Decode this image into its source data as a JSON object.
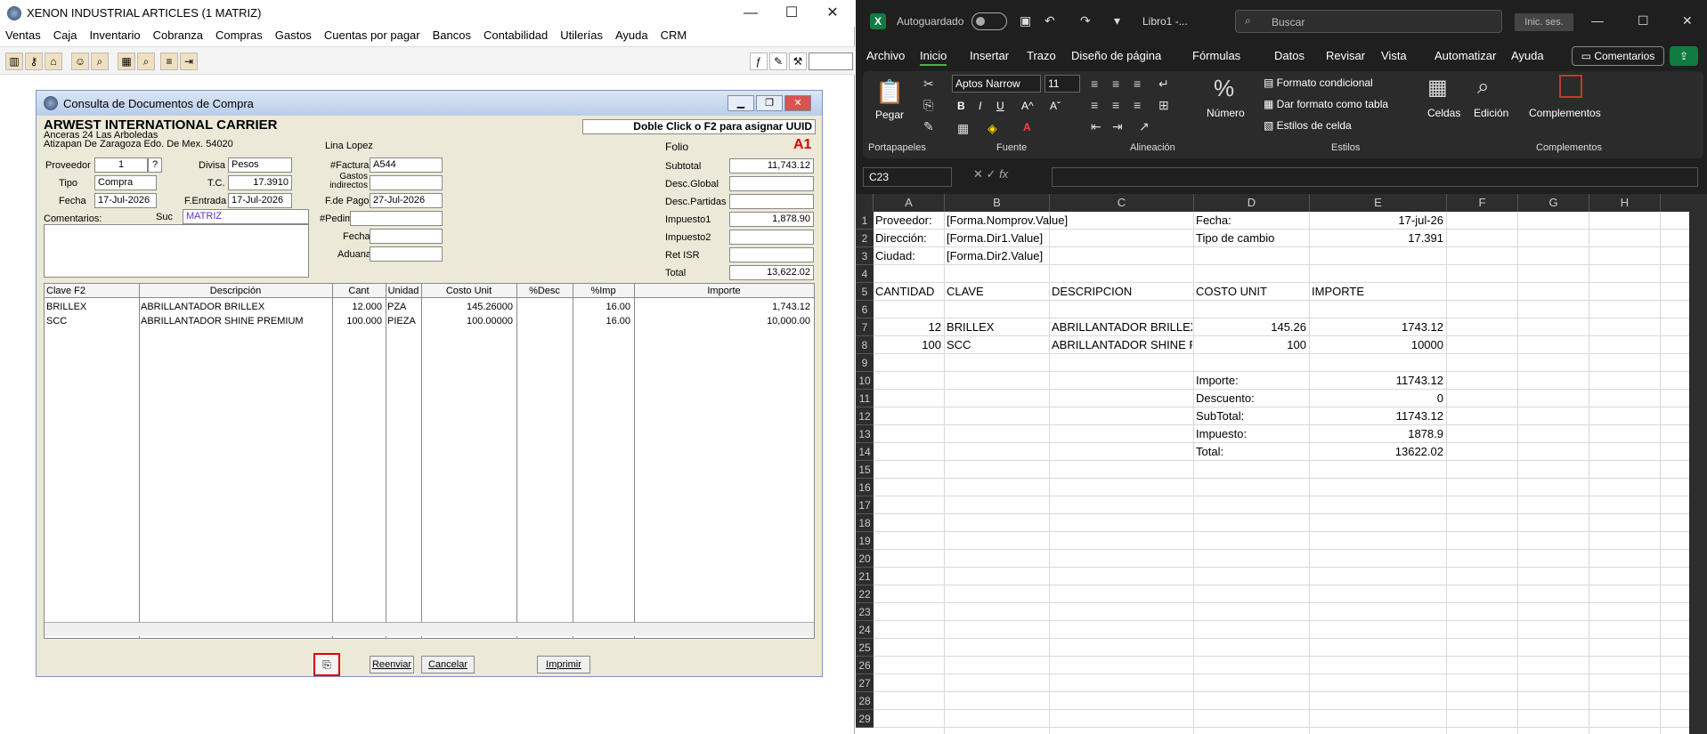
{
  "xenon": {
    "title": "XENON INDUSTRIAL ARTICLES  (1 MATRIZ)",
    "menu": [
      "Ventas",
      "Caja",
      "Inventario",
      "Cobranza",
      "Compras",
      "Gastos",
      "Cuentas por pagar",
      "Bancos",
      "Contabilidad",
      "Utilerías",
      "Ayuda",
      "CRM"
    ],
    "dialog": {
      "title": "Consulta de Documentos de Compra",
      "supplier_name": "ARWEST INTERNATIONAL CARRIER",
      "address1": "Anceras 24 Las Arboledas",
      "address2": "Atizapan De Zaragoza Edo. De Mex. 54020",
      "contact": "Lina Lopez",
      "uuid_hint": "Doble Click o F2 para asignar UUID",
      "folio_label": "Folio",
      "folio_value": "A1",
      "labels": {
        "proveedor": "Proveedor",
        "tipo": "Tipo",
        "fecha": "Fecha",
        "divisa": "Divisa",
        "tc": "T.C.",
        "fentrada": "F.Entrada",
        "factura": "#Factura",
        "gastos": "Gastos indirectos",
        "fpago": "F.de Pago",
        "comentarios": "Comentarios:",
        "suc": "Suc",
        "pedim": "#Pedim",
        "fecha2": "Fecha",
        "aduana": "Aduana"
      },
      "values": {
        "proveedor": "1",
        "tipo": "Compra",
        "fecha": "17-Jul-2026",
        "divisa": "Pesos",
        "tc": "17.3910",
        "fentrada": "17-Jul-2026",
        "factura": "A544",
        "fpago": "27-Jul-2026",
        "suc": "MATRIZ"
      },
      "totals": [
        {
          "label": "Subtotal",
          "value": "11,743.12"
        },
        {
          "label": "Desc.Global",
          "value": ""
        },
        {
          "label": "Desc.Partidas",
          "value": ""
        },
        {
          "label": "Impuesto1",
          "value": "1,878.90"
        },
        {
          "label": "Impuesto2",
          "value": ""
        },
        {
          "label": "Ret ISR",
          "value": ""
        },
        {
          "label": "Total",
          "value": "13,622.02"
        }
      ],
      "grid_headers": [
        "Clave  F2",
        "Descripción",
        "Cant",
        "Unidad",
        "Costo Unit",
        "%Desc",
        "%Imp",
        "Importe"
      ],
      "rows": [
        [
          "BRILLEX",
          "ABRILLANTADOR BRILLEX",
          "12.000",
          "PZA",
          "145.26000",
          "",
          "16.00",
          "1,743.12"
        ],
        [
          "SCC",
          "ABRILLANTADOR SHINE PREMIUM",
          "100.000",
          "PIEZA",
          "100.00000",
          "",
          "16.00",
          "10,000.00"
        ]
      ],
      "buttons": {
        "reenviar": "Reenviar",
        "cancelar": "Cancelar",
        "imprimir": "Imprimir"
      }
    }
  },
  "excel": {
    "autosave": "Autoguardado",
    "filename": "Libro1 -...",
    "search": "Buscar",
    "signin": "Inic. ses.",
    "tabs": [
      "Archivo",
      "Inicio",
      "Insertar",
      "Trazo",
      "Diseño de página",
      "Fórmulas",
      "Datos",
      "Revisar",
      "Vista",
      "Automatizar",
      "Ayuda"
    ],
    "comments": "Comentarios",
    "font": "Aptos Narrow",
    "size": "11",
    "ribbon": {
      "pegar": "Pegar",
      "portapapeles": "Portapapeles",
      "fuente": "Fuente",
      "alineacion": "Alineación",
      "numero": "Número",
      "formato_cond": "Formato condicional",
      "formato_tabla": "Dar formato como tabla",
      "estilos_celda": "Estilos de celda",
      "estilos": "Estilos",
      "celdas": "Celdas",
      "edicion": "Edición",
      "complementos": "Complementos"
    },
    "namebox": "C23",
    "columns": [
      "A",
      "B",
      "C",
      "D",
      "E",
      "F",
      "G",
      "H"
    ],
    "cells": [
      {
        "r": 1,
        "c": "A",
        "v": "Proveedor:"
      },
      {
        "r": 1,
        "c": "B",
        "v": "[Forma.Nomprov.Value]"
      },
      {
        "r": 1,
        "c": "D",
        "v": "Fecha:"
      },
      {
        "r": 1,
        "c": "E",
        "v": "17-jul-26",
        "align": "right"
      },
      {
        "r": 2,
        "c": "A",
        "v": "Dirección:"
      },
      {
        "r": 2,
        "c": "B",
        "v": "[Forma.Dir1.Value]"
      },
      {
        "r": 2,
        "c": "D",
        "v": "Tipo de cambio"
      },
      {
        "r": 2,
        "c": "E",
        "v": "17.391",
        "align": "right"
      },
      {
        "r": 3,
        "c": "A",
        "v": "Ciudad:"
      },
      {
        "r": 3,
        "c": "B",
        "v": "[Forma.Dir2.Value]"
      },
      {
        "r": 5,
        "c": "A",
        "v": "CANTIDAD"
      },
      {
        "r": 5,
        "c": "B",
        "v": "CLAVE"
      },
      {
        "r": 5,
        "c": "C",
        "v": "DESCRIPCION"
      },
      {
        "r": 5,
        "c": "D",
        "v": "COSTO UNIT"
      },
      {
        "r": 5,
        "c": "E",
        "v": "IMPORTE"
      },
      {
        "r": 7,
        "c": "A",
        "v": "12",
        "align": "right"
      },
      {
        "r": 7,
        "c": "B",
        "v": "BRILLEX"
      },
      {
        "r": 7,
        "c": "C",
        "v": "ABRILLANTADOR BRILLEX"
      },
      {
        "r": 7,
        "c": "D",
        "v": "145.26",
        "align": "right"
      },
      {
        "r": 7,
        "c": "E",
        "v": "1743.12",
        "align": "right"
      },
      {
        "r": 8,
        "c": "A",
        "v": "100",
        "align": "right"
      },
      {
        "r": 8,
        "c": "B",
        "v": "SCC"
      },
      {
        "r": 8,
        "c": "C",
        "v": "ABRILLANTADOR SHINE PR"
      },
      {
        "r": 8,
        "c": "D",
        "v": "100",
        "align": "right"
      },
      {
        "r": 8,
        "c": "E",
        "v": "10000",
        "align": "right"
      },
      {
        "r": 10,
        "c": "D",
        "v": "Importe:"
      },
      {
        "r": 10,
        "c": "E",
        "v": "11743.12",
        "align": "right"
      },
      {
        "r": 11,
        "c": "D",
        "v": "Descuento:"
      },
      {
        "r": 11,
        "c": "E",
        "v": "0",
        "align": "right"
      },
      {
        "r": 12,
        "c": "D",
        "v": "SubTotal:"
      },
      {
        "r": 12,
        "c": "E",
        "v": "11743.12",
        "align": "right"
      },
      {
        "r": 13,
        "c": "D",
        "v": "Impuesto:"
      },
      {
        "r": 13,
        "c": "E",
        "v": "1878.9",
        "align": "right"
      },
      {
        "r": 14,
        "c": "D",
        "v": "Total:"
      },
      {
        "r": 14,
        "c": "E",
        "v": "13622.02",
        "align": "right"
      }
    ],
    "row_count": 29
  },
  "colors": {
    "excel_green": "#107c41",
    "folio_red": "#e00000",
    "highlight": "#e00000"
  }
}
